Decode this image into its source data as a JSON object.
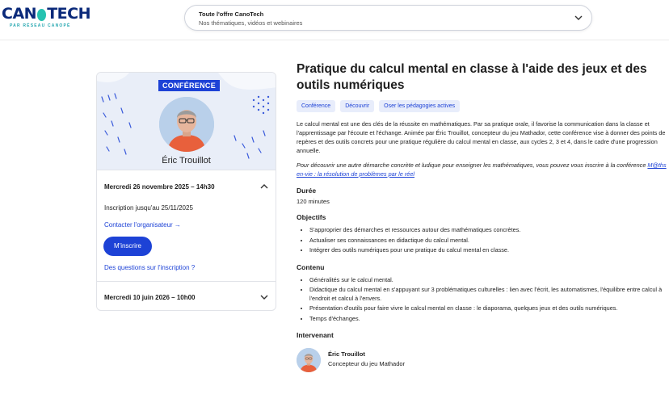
{
  "brand": {
    "logo_text_a": "CAN",
    "logo_text_b": "TECH",
    "logo_sub": "PAR RÉSEAU CANOPÉ",
    "color_primary": "#1d42d6",
    "color_teal": "#26c2b0"
  },
  "search": {
    "title": "Toute l'offre CanoTech",
    "subtitle": "Nos thématiques, vidéos et webinaires",
    "icon": "chevron-down-icon"
  },
  "card": {
    "badge": "CONFÉRENCE",
    "speaker": "Éric Trouillot",
    "sessions": [
      {
        "date": "Mercredi 26 novembre 2025 – 14h30",
        "expanded": true,
        "registration": "Inscription jusqu'au 25/11/2025",
        "contact": "Contacter l'organisateur →",
        "cta": "M'inscrire",
        "questions": "Des questions sur l'inscription ?"
      },
      {
        "date": "Mercredi 10 juin 2026 – 10h00",
        "expanded": false
      }
    ]
  },
  "main": {
    "title": "Pratique du calcul mental en classe à l'aide des jeux et des outils numériques",
    "tags": [
      "Conférence",
      "Découvrir",
      "Oser les pédagogies actives"
    ],
    "description": "Le calcul mental est une des clés de la réussite en mathématiques. Par sa pratique orale, il favorise la communication dans la classe et l'apprentissage par l'écoute et l'échange. Animée par Éric Trouillot, concepteur du jeu Mathador, cette conférence vise à donner des points de repères et des outils concrets pour une pratique régulière du calcul mental en classe, aux cycles 2, 3 et 4, dans le cadre d'une progression annuelle.",
    "note_prefix": "Pour découvrir une autre démarche concrète et ludique pour enseigner les mathématiques, vous pouvez vous inscrire à la conférence ",
    "note_link": "M@ths en-vie : la résolution de problèmes par le réel",
    "duration_heading": "Durée",
    "duration_value": "120 minutes",
    "objectives_heading": "Objectifs",
    "objectives": [
      "S'approprier des démarches et ressources autour des mathématiques concrètes.",
      "Actualiser ses connaissances en didactique du calcul mental.",
      "Intégrer des outils numériques pour une pratique du calcul mental en classe."
    ],
    "content_heading": "Contenu",
    "content": [
      "Généralités sur le calcul mental.",
      "Didactique du calcul mental en s'appuyant sur 3 problématiques culturelles : lien avec l'écrit, les automatismes, l'équilibre entre calcul à l'endroit et calcul à l'envers.",
      "Présentation d'outils pour faire vivre le calcul mental en classe : le diaporama, quelques jeux et des outils numériques.",
      "Temps d'échanges."
    ],
    "speaker_heading": "Intervenant",
    "speaker_name": "Éric Trouillot",
    "speaker_role": "Concepteur du jeu Mathador"
  }
}
